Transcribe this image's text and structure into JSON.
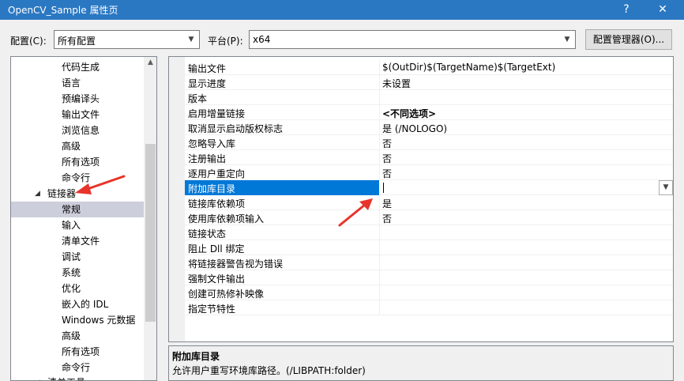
{
  "window": {
    "title": "OpenCV_Sample 属性页",
    "help_label": "?",
    "close_label": "✕"
  },
  "config_bar": {
    "config_label": "配置(C):",
    "config_value": "所有配置",
    "platform_label": "平台(P):",
    "platform_value": "x64",
    "manager_button": "配置管理器(O)..."
  },
  "tree": {
    "items": [
      {
        "label": "代码生成"
      },
      {
        "label": "语言"
      },
      {
        "label": "预编译头"
      },
      {
        "label": "输出文件"
      },
      {
        "label": "浏览信息"
      },
      {
        "label": "高级"
      },
      {
        "label": "所有选项"
      },
      {
        "label": "命令行"
      },
      {
        "label": "链接器",
        "expanded": true
      },
      {
        "label": "常规",
        "selected": true
      },
      {
        "label": "输入"
      },
      {
        "label": "清单文件"
      },
      {
        "label": "调试"
      },
      {
        "label": "系统"
      },
      {
        "label": "优化"
      },
      {
        "label": "嵌入的 IDL"
      },
      {
        "label": "Windows 元数据"
      },
      {
        "label": "高级"
      },
      {
        "label": "所有选项"
      },
      {
        "label": "命令行"
      },
      {
        "label": "清单工具"
      }
    ]
  },
  "grid": {
    "rows": [
      {
        "key": "输出文件",
        "value": "$(OutDir)$(TargetName)$(TargetExt)"
      },
      {
        "key": "显示进度",
        "value": "未设置"
      },
      {
        "key": "版本",
        "value": ""
      },
      {
        "key": "启用增量链接",
        "value": "<不同选项>",
        "bold": true
      },
      {
        "key": "取消显示启动版权标志",
        "value": "是 (/NOLOGO)"
      },
      {
        "key": "忽略导入库",
        "value": "否"
      },
      {
        "key": "注册输出",
        "value": "否"
      },
      {
        "key": "逐用户重定向",
        "value": "否"
      },
      {
        "key": "附加库目录",
        "value": "",
        "selected": true
      },
      {
        "key": "链接库依赖项",
        "value": "是"
      },
      {
        "key": "使用库依赖项输入",
        "value": "否"
      },
      {
        "key": "链接状态",
        "value": ""
      },
      {
        "key": "阻止 Dll 绑定",
        "value": ""
      },
      {
        "key": "将链接器警告视为错误",
        "value": ""
      },
      {
        "key": "强制文件输出",
        "value": ""
      },
      {
        "key": "创建可热修补映像",
        "value": ""
      },
      {
        "key": "指定节特性",
        "value": ""
      }
    ]
  },
  "description": {
    "title": "附加库目录",
    "text": "允许用户重写环境库路径。(/LIBPATH:folder)"
  },
  "annotation_color": "#e8332a"
}
